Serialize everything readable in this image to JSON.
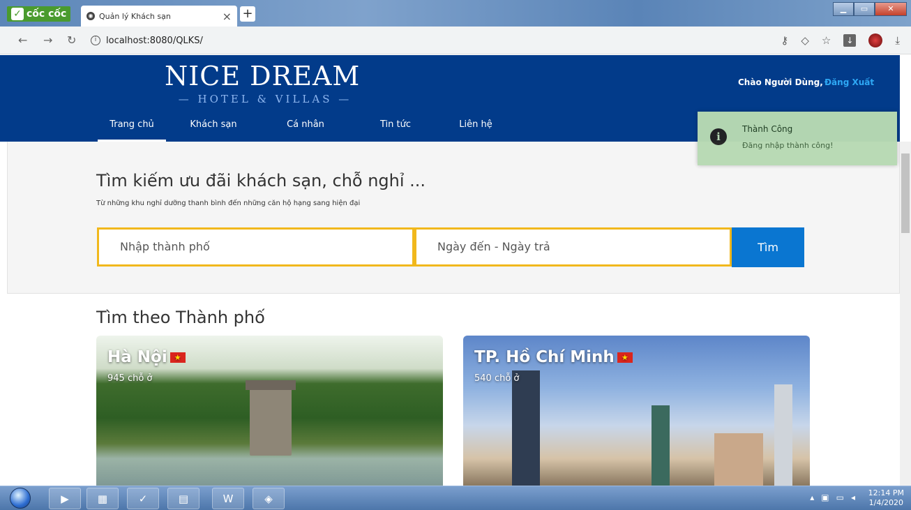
{
  "browser": {
    "brand": "cốc cốc",
    "tab_title": "Quản lý Khách sạn",
    "url": "localhost:8080/QLKS/"
  },
  "header": {
    "logo_main": "NICE DREAM",
    "logo_sub": "— HOTEL & VILLAS —",
    "greeting": "Chào Người Dùng,",
    "logout": "Đăng Xuất",
    "nav": [
      "Trang chủ",
      "Khách sạn",
      "Cá nhân",
      "Tin tức",
      "Liên hệ"
    ],
    "active_nav": "Trang chủ"
  },
  "toast": {
    "title": "Thành Công",
    "message": "Đăng nhập thành công!"
  },
  "hero": {
    "title": "Tìm kiếm ưu đãi khách sạn, chỗ nghỉ ...",
    "subtitle": "Từ những khu nghỉ dưỡng thanh bình đến những căn hộ hạng sang hiện đại",
    "city_placeholder": "Nhập thành phố",
    "date_placeholder": "Ngày đến - Ngày trả",
    "search_label": "Tìm"
  },
  "cities": {
    "section_title": "Tìm theo Thành phố",
    "items": [
      {
        "name": "Hà Nội",
        "count": "945 chỗ ở"
      },
      {
        "name": "TP. Hồ Chí Minh",
        "count": "540 chỗ ở"
      }
    ]
  },
  "taskbar": {
    "time": "12:14 PM",
    "date": "1/4/2020"
  },
  "colors": {
    "header_bg": "#023b8a",
    "accent_blue": "#0a76d1",
    "input_border": "#f1b81c",
    "toast_bg": "#b8dab3"
  }
}
